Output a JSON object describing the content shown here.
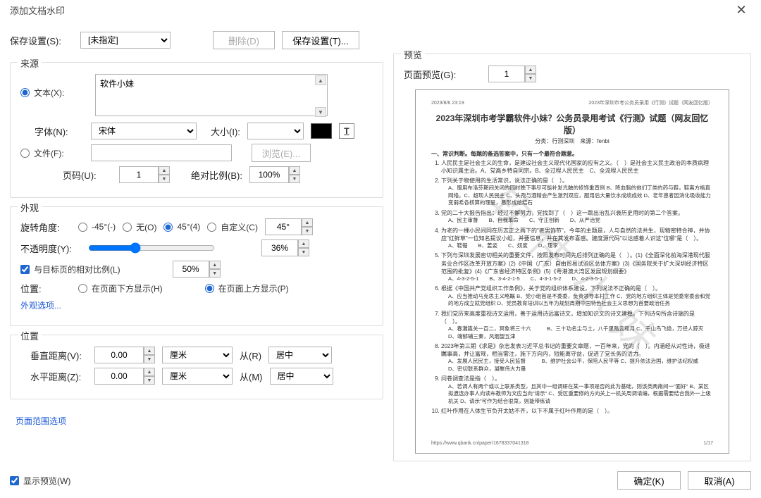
{
  "title": "添加文档水印",
  "save_settings_label": "保存设置(S):",
  "save_settings_value": "[未指定]",
  "delete_btn": "删除(D)",
  "save_btn": "保存设置(T)...",
  "source": {
    "legend": "来源",
    "text_radio": "文本(X):",
    "text_value": "软件小妹",
    "font_label": "字体(N):",
    "font_value": "宋体",
    "size_label": "大小(I):",
    "size_value": "",
    "underline": "T",
    "file_radio": "文件(F):",
    "file_value": "",
    "browse_btn": "浏览(E)...",
    "page_label": "页码(U):",
    "page_value": "1",
    "scale_label": "绝对比例(B):",
    "scale_value": "100%"
  },
  "appearance": {
    "legend": "外观",
    "rotation_label": "旋转角度:",
    "rot_neg45": "-45°(-)",
    "rot_none": "无(O)",
    "rot_45": "45°(4)",
    "rot_custom": "自定义(C)",
    "rot_custom_value": "45°",
    "opacity_label": "不透明度(Y):",
    "opacity_value": "36%",
    "relative_scale_label": "与目标页的相对比例(L)",
    "relative_scale_value": "50%",
    "position_label": "位置:",
    "behind": "在页面下方显示(H)",
    "above": "在页面上方显示(P)",
    "options_link": "外观选项..."
  },
  "position": {
    "legend": "位置",
    "vdist_label": "垂直距离(V):",
    "hdist_label": "水平距离(Z):",
    "vdist_value": "0.00",
    "hdist_value": "0.00",
    "unit": "厘米",
    "from_r": "从(R)",
    "from_m": "从(M)",
    "anchor": "居中"
  },
  "page_range_link": "页面范围选项",
  "show_preview": "显示预览(W)",
  "preview": {
    "legend": "预览",
    "page_label": "页面预览(G):",
    "page_value": "1",
    "doc": {
      "header_left": "2023/8/6 23:19",
      "header_right": "2023年深圳市考公务员录用《行测》试题（网友回忆版）",
      "title": "2023年深圳市考学霸软件小妹？公务员录用考试《行测》试题（网友回忆版）",
      "meta": "分类：行测深圳　来源：fenbi",
      "section": "一、常识判断。每题的备选答案中，只有一个最符合题意。",
      "q1": "人民民主是社会主义的生命，是建设社会主义现代化国家的应有之义。（　）是社会主义民主政治的本质病理小知识属主治。A、党高乡特自同宗。B、全过程人民民主　C、全流程人民民主",
      "q2": "下列关于物使用的生活常识，说法正确的是（　）。",
      "q2o": "A、服用布洛芬期间关闭的同时晚下事尽可能补发光触的修饰重直例\nB、降血脂的他们丁类的药与鞋，鞋离方格真网络。C、超现人民民主\nC、头孢与酒精会产生激烈双应，服用后大量饮水成绩成效\nD、老年患者因消化吸收能力变弱希各核算的理呈，易形成给结石",
      "q3": "党的二十大报告指出：经过不懈努力，党找到了（　）这一跳出治乱兴衰历史用时的第二个答案。",
      "q3o": "A、民主审督　　B、自我革命　　C、守正创新　　D、从严治党",
      "q4": "为老的一棵小民间同在历志正之两下的\"裤男饰节\"，今年的主题是，人与自然的法共生，现物密特合神，并协应\"红鲜草\"一位知名提议小组，并要信息，并在其发布喜感。建度源代码\"以达感着人识这\"位哪\"是（　）。",
      "q4o": "A、鞋锯　　B、姜姿　　C、奴度　　D、理李",
      "q5": "下列与深圳发展密切相关的重要文件，按照发布时间先后排列正确的是（　）。(1)《全面深化前海深港现代服务业合作区改革开放方案》(2)《中国（广东）自由贸易试验区总体方案》(3)《国务院关于扩大深圳经济特区范围的批复》(4)《广东省经济特区条例》(5)《粤港澳大湾区发展规划纲要》",
      "q5o": "A、4-3-2-5-1　　B、3-4-2-1-5　　C、4-3-1-5-2　　D、4-2-3-5-1",
      "q6": "根据《中国共产党组织工作条例》，关于党的组织体系建设，下列说法不正确的是（　）。",
      "q6o": "A、应当推动马克思主义略瞩\nB、党小组首是不委委，负责领导本村工作\nC、党的地方组织主体是党委常委会和党的地方成立就党组织\nD、党员教育培训以五年为规划周期中国特色社会主义思想为首要政治任务",
      "q7": "我们党历来高度重视诗文运用，善于运用诗远富诗文，增加知识文的诗文建稳。下列诗句所含诗端的是（　）。",
      "q7o": "A、春灘篇关一百二，冥象将三十六　　　B、三十功名尘与土，八千里路云和月\nC、千山鸟飞绝，万径人踪灭　　　　　　D、端郁辅三秦，风烟望五津",
      "q8": "2023年第三期《求是》杂志发表习近平总书记的重要文章题，一百年来，党的（　）。内涵经从对性诗，极进瞩事高，并让富规，相当需注，施下方向内，短能离守益，促进了党长务的活力。",
      "q8o": "A、发展人民民主，接受人民监督　　　B、维护社会公平，保陪人民平等\nC、提升依法治国，维护法纪权威　　　D、密切联系群众，凝聚伟大力量",
      "q9": "问卷调查法是指（　）。",
      "q9o": "A、若调人有两个或以上联系类型，且其中一组调研在某一事项是否的此为基础，则该类两南间一\"面好\"\nB、某区拟遗选办事人向读布教师为文应当向\"请示\"\nC、受区重要修的方向关上一机关周调请编，根据需要结合我外一上级机关\nD、请示\"可作为结合很菜，则能带练请",
      "q10": "红叶作用在人体生节负开太姑不齐，以下不属于红叶作用的是（　）。",
      "footer_left": "https://www.qbank.cn/paper/1678337041318",
      "footer_right": "1/17",
      "watermark": "软 件 小 妹"
    }
  },
  "ok_btn": "确定(K)",
  "cancel_btn": "取消(A)"
}
